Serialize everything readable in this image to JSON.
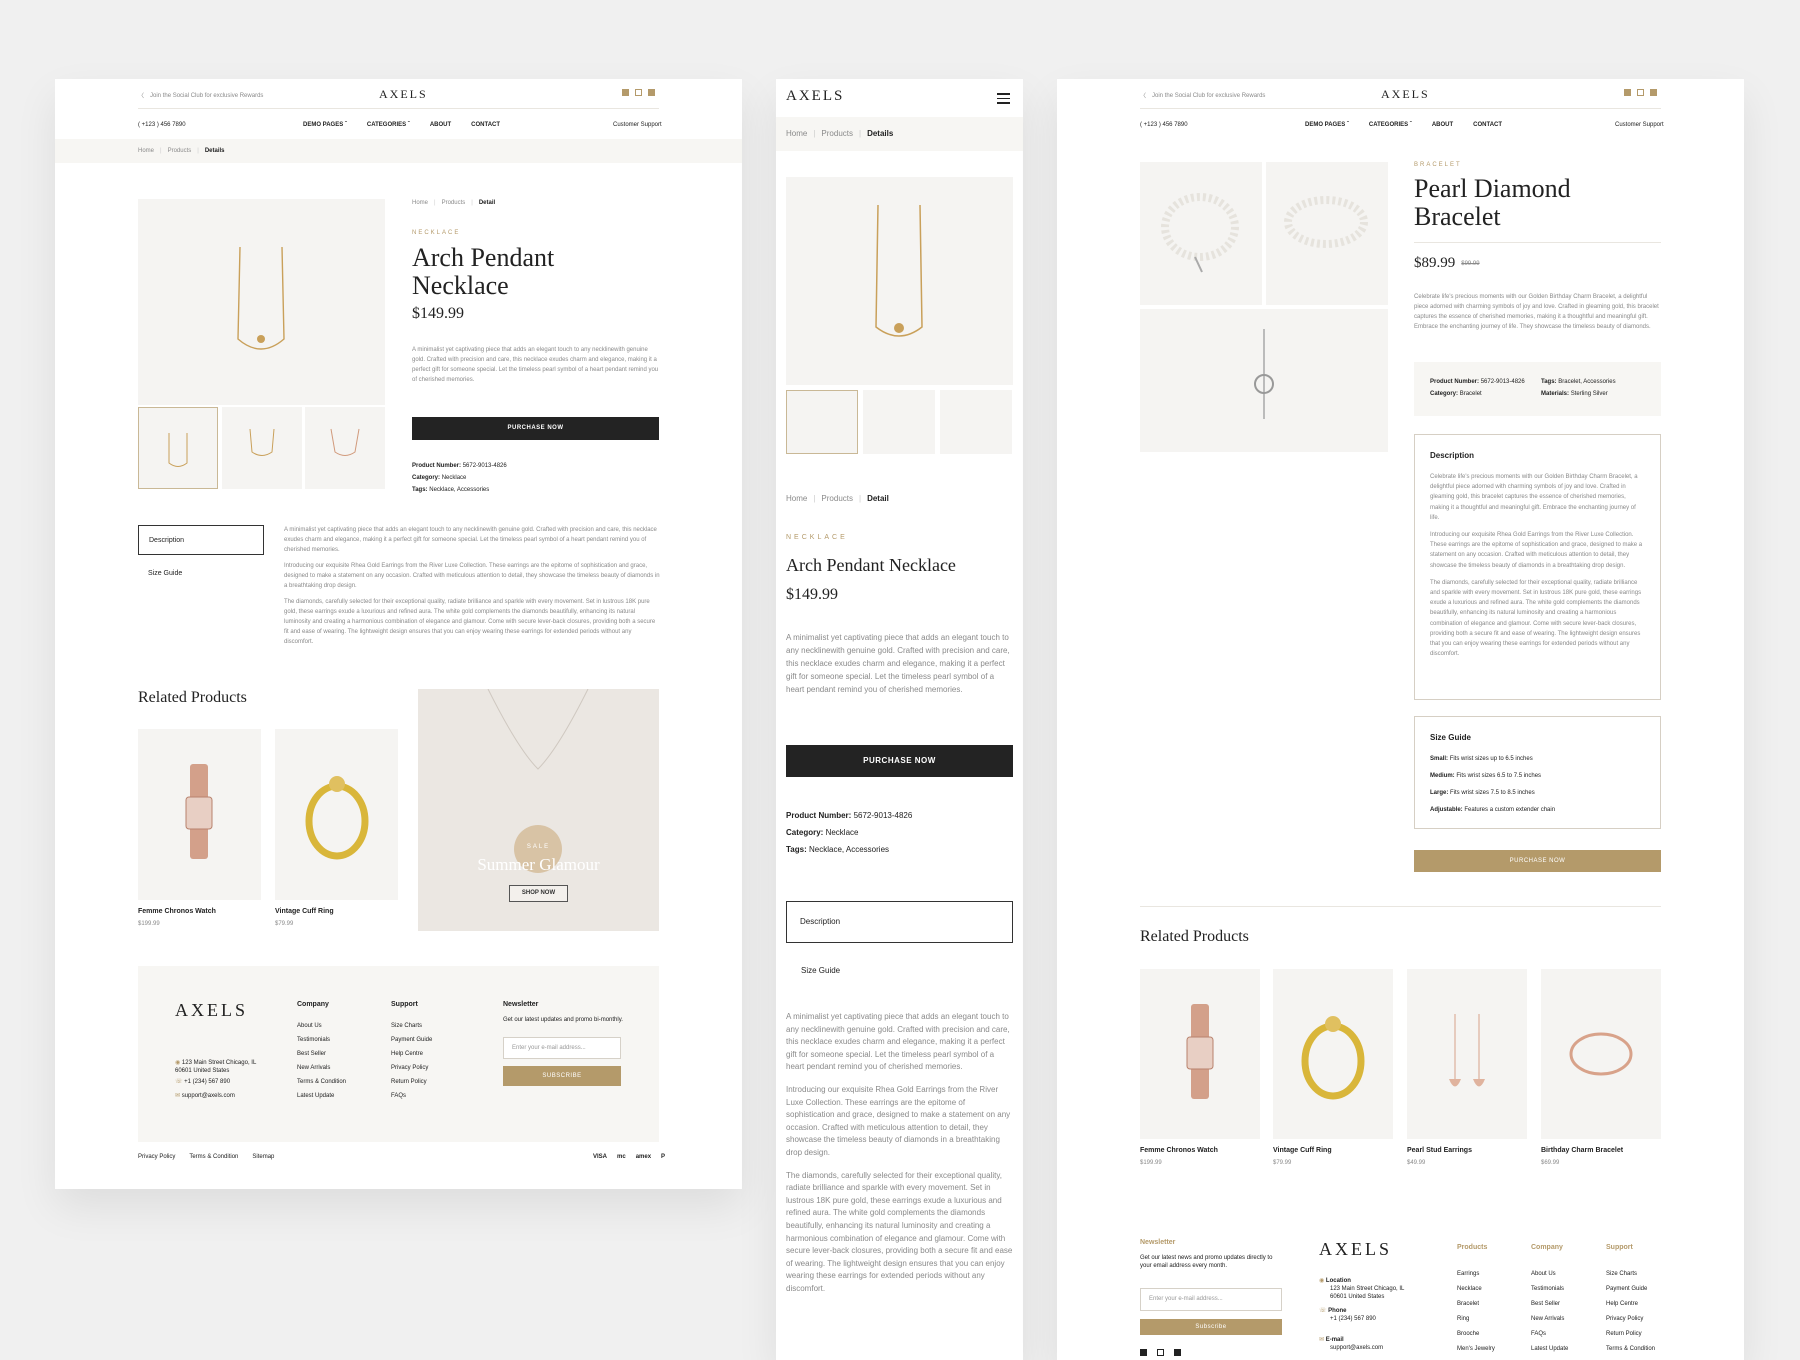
{
  "colors": {
    "gold": "#b49a6a",
    "dark": "#232323",
    "bg": "#f0f0f0",
    "soft": "#f5f4f2"
  },
  "brand": "AXELS",
  "topbar": {
    "promo": "Join the Social Club for exclusive Rewards",
    "phone": "( +123 ) 456 7890",
    "support": "Customer Support"
  },
  "nav": [
    "DEMO PAGES",
    "CATEGORIES",
    "ABOUT",
    "CONTACT"
  ],
  "social_icons": [
    "x-icon",
    "instagram-icon",
    "facebook-icon"
  ],
  "crumbs": {
    "home": "Home",
    "products": "Products",
    "details": "Details",
    "detail": "Detail"
  },
  "necklace": {
    "category": "NECKLACE",
    "title_l1": "Arch Pendant",
    "title_l2": "Necklace",
    "title_full": "Arch Pendant Necklace",
    "price": "$149.99",
    "desc": "A minimalist yet captivating piece that adds an elegant touch to any necklinewith genuine gold. Crafted with precision and care, this necklace exudes charm and elegance, making it a perfect gift for someone special. Let the timeless pearl symbol of a heart pendant remind you of cherished memories.",
    "purchase": "PURCHASE NOW",
    "product_number_label": "Product Number:",
    "product_number": "5672-9013-4826",
    "category_label": "Category:",
    "category_value": "Necklace",
    "tags_label": "Tags:",
    "tags_value": "Necklace, Accessories"
  },
  "tabs": {
    "description": "Description",
    "size_guide": "Size Guide"
  },
  "long_desc": {
    "p1": "A minimalist yet captivating piece that adds an elegant touch to any necklinewith genuine gold. Crafted with precision and care, this necklace exudes charm and elegance, making it a perfect gift for someone special. Let the timeless pearl symbol of a heart pendant remind you of cherished memories.",
    "p2": "Introducing our exquisite Rhea Gold Earrings from the River Luxe Collection. These earrings are the epitome of sophistication and grace, designed to make a statement on any occasion. Crafted with meticulous attention to detail, they showcase the timeless beauty of diamonds in a breathtaking drop design.",
    "p3": "The diamonds, carefully selected for their exceptional quality, radiate brilliance and sparkle with every movement. Set in lustrous 18K pure gold, these earrings exude a luxurious and refined aura. The white gold complements the diamonds beautifully, enhancing its natural luminosity and creating a harmonious combination of elegance and glamour. Come with secure lever-back closures, providing both a secure fit and ease of wearing. The lightweight design ensures that you can enjoy wearing these earrings for extended periods without any discomfort."
  },
  "related": {
    "title": "Related Products",
    "items": [
      {
        "name": "Femme Chronos Watch",
        "price": "$199.99"
      },
      {
        "name": "Vintage Cuff Ring",
        "price": "$79.99"
      },
      {
        "name": "Pearl Stud Earrings",
        "price": "$49.99"
      },
      {
        "name": "Birthday Charm Bracelet",
        "price": "$69.99"
      }
    ]
  },
  "promo_banner": {
    "tag": "SALE",
    "title": "Summer Glamour",
    "cta": "SHOP NOW"
  },
  "footer": {
    "address": "123 Main Street Chicago, IL 60601 United States",
    "phone": "+1 (234) 567 890",
    "email": "support@axels.com",
    "company_title": "Company",
    "company": [
      "About Us",
      "Testimonials",
      "Best Seller",
      "New Arrivals",
      "Terms & Condition",
      "Latest Update"
    ],
    "support_title": "Support",
    "support": [
      "Size Charts",
      "Payment Guide",
      "Help Centre",
      "Privacy Policy",
      "Return Policy",
      "FAQs"
    ],
    "newsletter_title": "Newsletter",
    "newsletter_text": "Get our latest updates and promo bi-monthly.",
    "email_placeholder": "Enter your e-mail address...",
    "subscribe": "SUBSCRIBE",
    "bottom": [
      "Privacy Policy",
      "Terms & Condition",
      "Sitemap"
    ],
    "payments": [
      "VISA",
      "mc",
      "amex",
      "P"
    ]
  },
  "bracelet": {
    "category": "BRACELET",
    "title_l1": "Pearl Diamond",
    "title_l2": "Bracelet",
    "price": "$89.99",
    "old_price": "$99.99",
    "desc": "Celebrate life's precious moments with our Golden Birthday Charm Bracelet, a delightful piece adorned with charming symbols of joy and love. Crafted in gleaming gold, this bracelet captures the essence of cherished memories, making it a thoughtful and meaningful gift. Embrace the enchanting journey of life. They showcase the timeless beauty of diamonds.",
    "product_number_label": "Product Number:",
    "product_number": "5672-9013-4826",
    "tags_label": "Tags:",
    "tags_value": "Bracelet, Accessories",
    "category_label": "Category:",
    "category_value": "Bracelet",
    "materials_label": "Materials:",
    "materials_value": "Sterling Silver",
    "description_title": "Description",
    "d1": "Celebrate life's precious moments with our Golden Birthday Charm Bracelet, a delightful piece adorned with charming symbols of joy and love. Crafted in gleaming gold, this bracelet captures the essence of cherished memories, making it a thoughtful and meaningful gift. Embrace the enchanting journey of life.",
    "d2": "Introducing our exquisite Rhea Gold Earrings from the River Luxe Collection. These earrings are the epitome of sophistication and grace, designed to make a statement on any occasion. Crafted with meticulous attention to detail, they showcase the timeless beauty of diamonds in a breathtaking drop design.",
    "d3": "The diamonds, carefully selected for their exceptional quality, radiate brilliance and sparkle with every movement. Set in lustrous 18K pure gold, these earrings exude a luxurious and refined aura. The white gold complements the diamonds beautifully, enhancing its natural luminosity and creating a harmonious combination of elegance and glamour. Come with secure lever-back closures, providing both a secure fit and ease of wearing. The lightweight design ensures that you can enjoy wearing these earrings for extended periods without any discomfort.",
    "size_title": "Size Guide",
    "sizes": [
      {
        "label": "Small:",
        "value": "Fits wrist sizes up to 6.5 inches"
      },
      {
        "label": "Medium:",
        "value": "Fits wrist sizes 6.5 to 7.5 inches"
      },
      {
        "label": "Large:",
        "value": "Fits wrist sizes 7.5 to 8.5 inches"
      },
      {
        "label": "Adjustable:",
        "value": "Features a custom extender chain"
      }
    ],
    "purchase": "PURCHASE NOW"
  },
  "footer3": {
    "newsletter_title": "Newsletter",
    "newsletter_text": "Get our latest news and promo updates directly to your email address every month.",
    "email_placeholder": "Enter your e-mail address...",
    "subscribe": "Subscribe",
    "location_label": "Location",
    "location": "123 Main Street Chicago, IL 60601 United States",
    "phone_label": "Phone",
    "phone": "+1 (234) 567 890",
    "email_label": "E-mail",
    "email": "support@axels.com",
    "products_title": "Products",
    "products": [
      "Earrings",
      "Necklace",
      "Bracelet",
      "Ring",
      "Brooche",
      "Men's Jewelry"
    ],
    "company_title": "Company",
    "company": [
      "About Us",
      "Testimonials",
      "Best Seller",
      "New Arrivals",
      "FAQs",
      "Latest Update"
    ],
    "support_title": "Support",
    "support": [
      "Size Charts",
      "Payment Guide",
      "Help Centre",
      "Privacy Policy",
      "Return Policy",
      "Terms & Condition"
    ]
  }
}
